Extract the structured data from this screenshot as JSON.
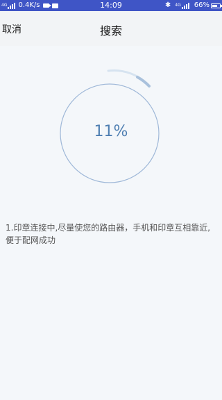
{
  "status_bar": {
    "network_left": "4G",
    "speed": "0.4K/s",
    "time": "14:09",
    "network_right": "4G",
    "battery": "66%"
  },
  "nav": {
    "cancel_label": "取消",
    "title": "搜索"
  },
  "progress": {
    "value": 11,
    "label": "11%"
  },
  "instructions": {
    "text": "1.印章连接中,尽量使您的路由器，手机和印章互相靠近,便于配网成功"
  },
  "colors": {
    "status_bar": "#3f55c6",
    "ring": "#9fb8d8",
    "progress_text": "#4f7fb2",
    "background": "#f4f7fa"
  }
}
